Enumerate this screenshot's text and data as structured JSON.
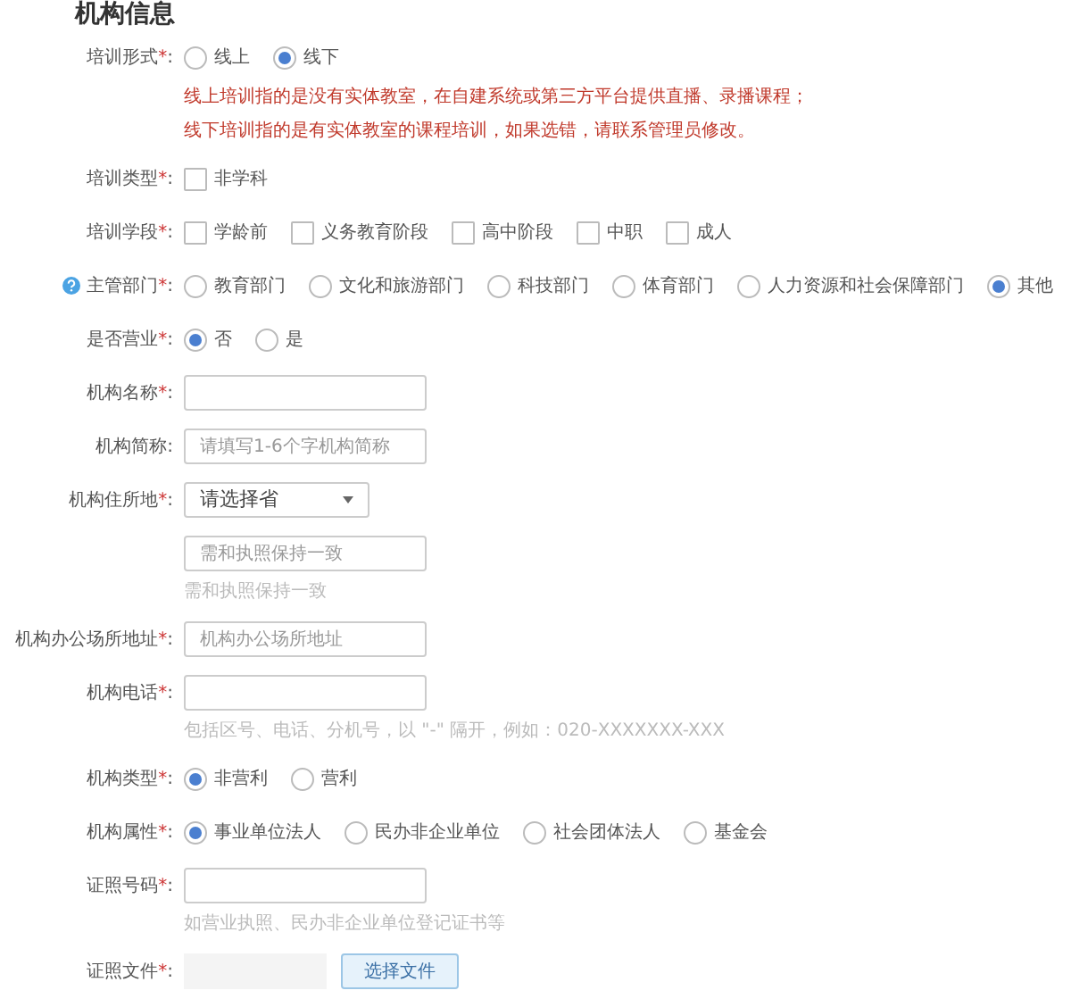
{
  "title": "机构信息",
  "fields": [
    {
      "kind": "radio",
      "label": "培训形式",
      "required_mark": "*",
      "colon": ":",
      "options": [
        {
          "label": "线上",
          "selected": false
        },
        {
          "label": "线下",
          "selected": true
        }
      ],
      "notes": [
        "线上培训指的是没有实体教室，在自建系统或第三方平台提供直播、录播课程；",
        "线下培训指的是有实体教室的课程培训，如果选错，请联系管理员修改。"
      ]
    },
    {
      "kind": "checkbox",
      "label": "培训类型",
      "required_mark": "*",
      "colon": ":",
      "options": [
        {
          "label": "非学科",
          "checked": false
        }
      ]
    },
    {
      "kind": "checkbox",
      "label": "培训学段",
      "required_mark": "*",
      "colon": ":",
      "options": [
        {
          "label": "学龄前",
          "checked": false
        },
        {
          "label": "义务教育阶段",
          "checked": false
        },
        {
          "label": "高中阶段",
          "checked": false
        },
        {
          "label": "中职",
          "checked": false
        },
        {
          "label": "成人",
          "checked": false
        }
      ]
    },
    {
      "kind": "radio",
      "help": true,
      "label": "主管部门",
      "required_mark": "*",
      "colon": ":",
      "options": [
        {
          "label": "教育部门",
          "selected": false
        },
        {
          "label": "文化和旅游部门",
          "selected": false
        },
        {
          "label": "科技部门",
          "selected": false
        },
        {
          "label": "体育部门",
          "selected": false
        },
        {
          "label": "人力资源和社会保障部门",
          "selected": false
        },
        {
          "label": "其他",
          "selected": true
        }
      ]
    },
    {
      "kind": "radio",
      "label": "是否营业",
      "required_mark": "*",
      "colon": ":",
      "options": [
        {
          "label": "否",
          "selected": true
        },
        {
          "label": "是",
          "selected": false
        }
      ]
    },
    {
      "kind": "text",
      "label": "机构名称",
      "required_mark": "*",
      "colon": ":"
    },
    {
      "kind": "text",
      "label": "机构简称",
      "colon": ":",
      "placeholder": "请填写1-6个字机构简称"
    },
    {
      "kind": "select",
      "label": "机构住所地",
      "required_mark": "*",
      "colon": ":",
      "value": "请选择省"
    },
    {
      "kind": "text",
      "placeholder": "需和执照保持一致",
      "hint": "需和执照保持一致"
    },
    {
      "kind": "text",
      "label": "机构办公场所地址",
      "required_mark": "*",
      "colon": ":",
      "placeholder": "机构办公场所地址"
    },
    {
      "kind": "text",
      "label": "机构电话",
      "required_mark": "*",
      "colon": ":",
      "hint": "包括区号、电话、分机号，以 \"-\" 隔开，例如：020-XXXXXXX-XXX"
    },
    {
      "kind": "radio",
      "label": "机构类型",
      "required_mark": "*",
      "colon": ":",
      "options": [
        {
          "label": "非营利",
          "selected": true
        },
        {
          "label": "营利",
          "selected": false
        }
      ]
    },
    {
      "kind": "radio",
      "label": "机构属性",
      "required_mark": "*",
      "colon": ":",
      "options": [
        {
          "label": "事业单位法人",
          "selected": true
        },
        {
          "label": "民办非企业单位",
          "selected": false
        },
        {
          "label": "社会团体法人",
          "selected": false
        },
        {
          "label": "基金会",
          "selected": false
        }
      ]
    },
    {
      "kind": "text",
      "label": "证照号码",
      "required_mark": "*",
      "colon": ":",
      "hint": "如营业执照、民办非企业单位登记证书等"
    },
    {
      "kind": "file",
      "label": "证照文件",
      "required_mark": "*",
      "colon": ":",
      "button": "选择文件"
    }
  ]
}
